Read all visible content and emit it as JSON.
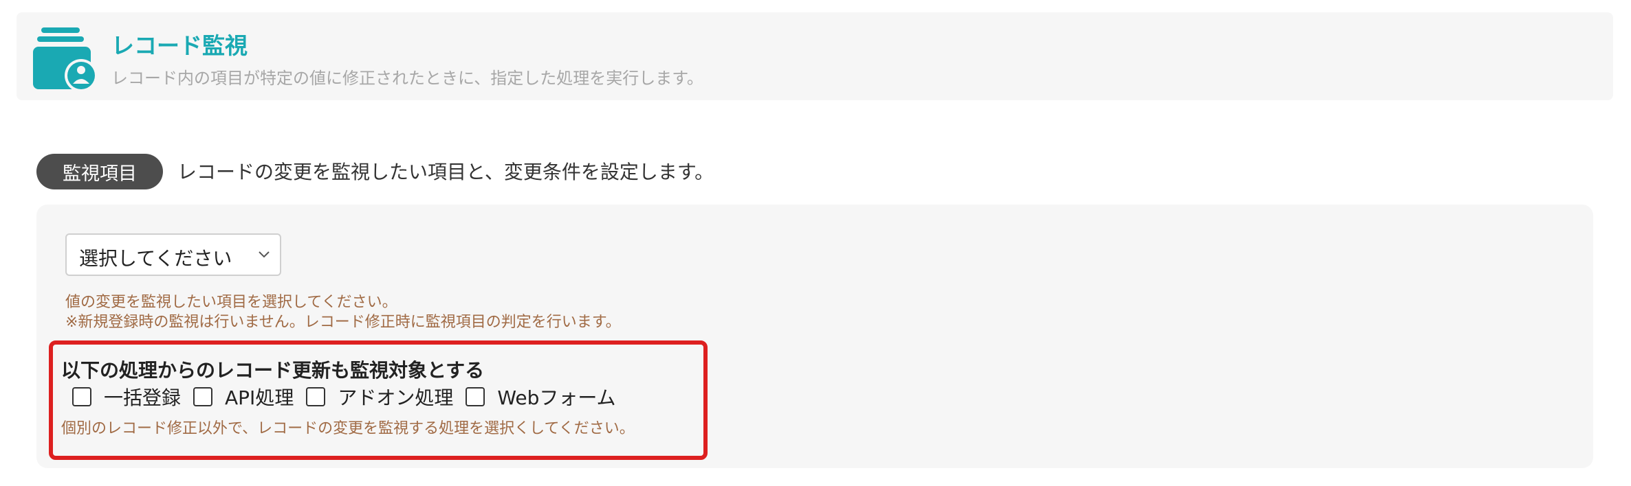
{
  "header": {
    "icon": "record-monitor-icon",
    "title": "レコード監視",
    "description": "レコード内の項目が特定の値に修正されたときに、指定した処理を実行します。",
    "accent_color": "#1aa9b3"
  },
  "section": {
    "badge": "監視項目",
    "description": "レコードの変更を監視したい項目と、変更条件を設定します。"
  },
  "panel": {
    "select": {
      "selected": "選択してください",
      "icon": "chevron-down-icon"
    },
    "hint_line1": "値の変更を監視したい項目を選択してください。",
    "hint_line2": "※新規登録時の監視は行いません。レコード修正時に監視項目の判定を行います。",
    "hint_color": "#a06a44",
    "highlight": {
      "border_color": "#dd2020",
      "title": "以下の処理からのレコード更新も監視対象とする",
      "checkboxes": [
        {
          "label": "一括登録",
          "checked": false
        },
        {
          "label": "API処理",
          "checked": false
        },
        {
          "label": "アドオン処理",
          "checked": false
        },
        {
          "label": "Webフォーム",
          "checked": false
        }
      ],
      "hint": "個別のレコード修正以外で、レコードの変更を監視する処理を選択くしてください。"
    }
  }
}
